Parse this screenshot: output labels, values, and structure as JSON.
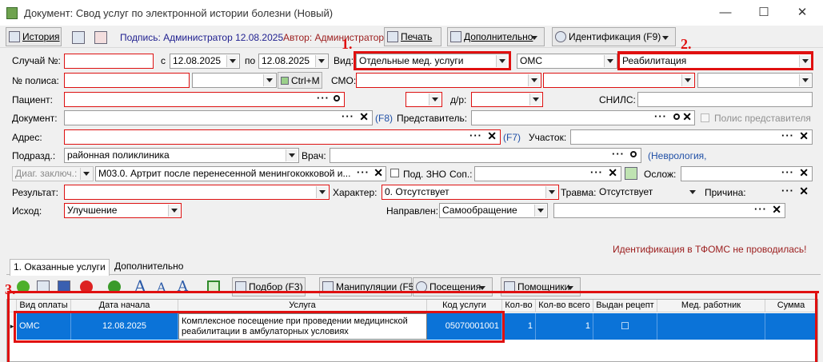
{
  "window": {
    "title": "Документ: Свод услуг по электронной истории болезни (Новый)",
    "minimize": "—",
    "maximize": "☐",
    "close": "✕"
  },
  "toolbar": {
    "history": "История",
    "signature": "Подпись: Администратор 12.08.2025",
    "author": "Автор: Администратор",
    "print": "Печать",
    "more": "Дополнительно",
    "ident": "Идентификация (F9)"
  },
  "form": {
    "case_label": "Случай №:",
    "case_value": "",
    "from_label": "с",
    "date_from": "12.08.2025",
    "to_label": "по",
    "date_to": "12.08.2025",
    "type_label": "Вид:",
    "type_value": "Отдельные мед. услуги",
    "fund_value": "ОМС",
    "profile_value": "Реабилитация",
    "policy_label": "№ полиса:",
    "ctrlm": "Ctrl+M",
    "smo_label": "СМО:",
    "patient_label": "Пациент:",
    "dob_label": "д/р:",
    "snils_label": "СНИЛС:",
    "document_label": "Документ:",
    "f8": "(F8)",
    "representative_label": "Представитель:",
    "rep_policy": "Полис представителя",
    "address_label": "Адрес:",
    "f7": "(F7)",
    "district_label": "Участок:",
    "dept_label": "Подразд.:",
    "dept_value": "районная поликлиника",
    "doctor_label": "Врач:",
    "specialty": "(Неврология,",
    "diag_label": "Диаг. заключ.:",
    "diag_value": "M03.0. Артрит после перенесенной менингококковой и...",
    "zno_label": "Под. ЗНО",
    "comp_label": "Соп.:",
    "complication_label": "Ослож:",
    "result_label": "Результат:",
    "character_label": "Характер:",
    "character_value": "0. Отсутствует",
    "trauma_label": "Травма:",
    "trauma_value": "Отсутствует",
    "cause_label": "Причина:",
    "outcome_label": "Исход:",
    "outcome_value": "Улучшение",
    "direction_label": "Направлен:",
    "direction_value": "Самообращение",
    "tfoms_msg": "Идентификация в ТФОМС не проводилась!"
  },
  "annotations": [
    "1.",
    "2.",
    "3."
  ],
  "tabs": [
    "1. Оказанные услуги",
    "Дополнительно"
  ],
  "grid_toolbar": {
    "select": "Подбор (F3)",
    "manip": "Манипуляции (F5)",
    "visits": "Посещения",
    "helpers": "Помощники"
  },
  "columns": [
    "Вид оплаты",
    "Дата начала",
    "Услуга",
    "Код услуги",
    "Кол-во",
    "Кол-во всего",
    "Выдан рецепт",
    "Мед. работник",
    "Сумма"
  ],
  "rows": [
    {
      "payment": "ОМС",
      "start": "12.08.2025",
      "service": "Комплексное посещение при проведении медицинской реабилитации в амбулаторных условиях",
      "code": "05070001001",
      "qty": "1",
      "qty_total": "1",
      "prescription": "☐",
      "staff": "",
      "sum": ""
    }
  ],
  "colors": {
    "required": "#d11111",
    "annotation": "#e01010",
    "selection": "#0b73d8",
    "link": "#1f4fa6"
  }
}
